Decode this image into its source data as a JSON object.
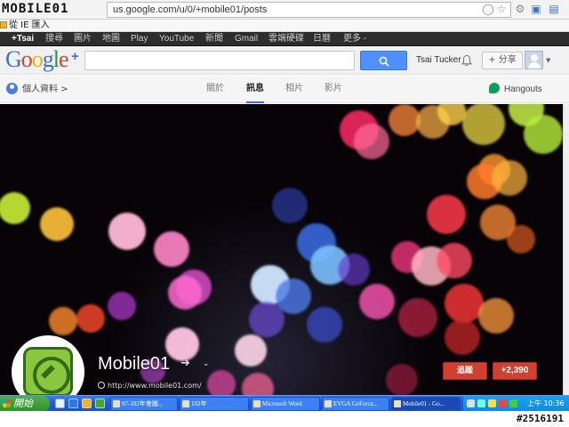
{
  "browser": {
    "watermark_logo": "MOBILE01",
    "url": "us.google.com/u/0/+mobile01/posts",
    "bookmark_label": "從 IE 匯入"
  },
  "gbar": {
    "items": [
      "+Tsai",
      "搜尋",
      "圖片",
      "地圖",
      "Play",
      "YouTube",
      "新聞",
      "Gmail",
      "雲端硬碟",
      "日曆",
      "更多 -"
    ]
  },
  "header": {
    "logo_text": "Google",
    "logo_plus": "+",
    "search_placeholder": "",
    "user_name": "Tsai Tucker",
    "share_label": "+ 分享"
  },
  "nav": {
    "profile_label": "個人資料 >",
    "tabs": [
      "關於",
      "訊息",
      "相片",
      "影片"
    ],
    "active_tab": "訊息",
    "hangouts_label": "Hangouts"
  },
  "profile": {
    "name": "Mobile01",
    "url": "http://www.mobile01.com/",
    "follow_label": "追蹤",
    "plusone_label": "+2,390"
  },
  "taskbar": {
    "start_label": "開始",
    "tasks": [
      "97-102年會圖...",
      "102年",
      "Microsoft Word",
      "EVGA GeForce...",
      "Mobile01 - Go..."
    ],
    "time": "上午 10:36"
  },
  "footer": {
    "watermark_id": "#2516191"
  },
  "colors": {
    "google_blue": "#4d90fe",
    "follow_red": "#d23f31",
    "gbar_bg": "#2d2d2d",
    "taskbar_blue": "#245edb"
  }
}
